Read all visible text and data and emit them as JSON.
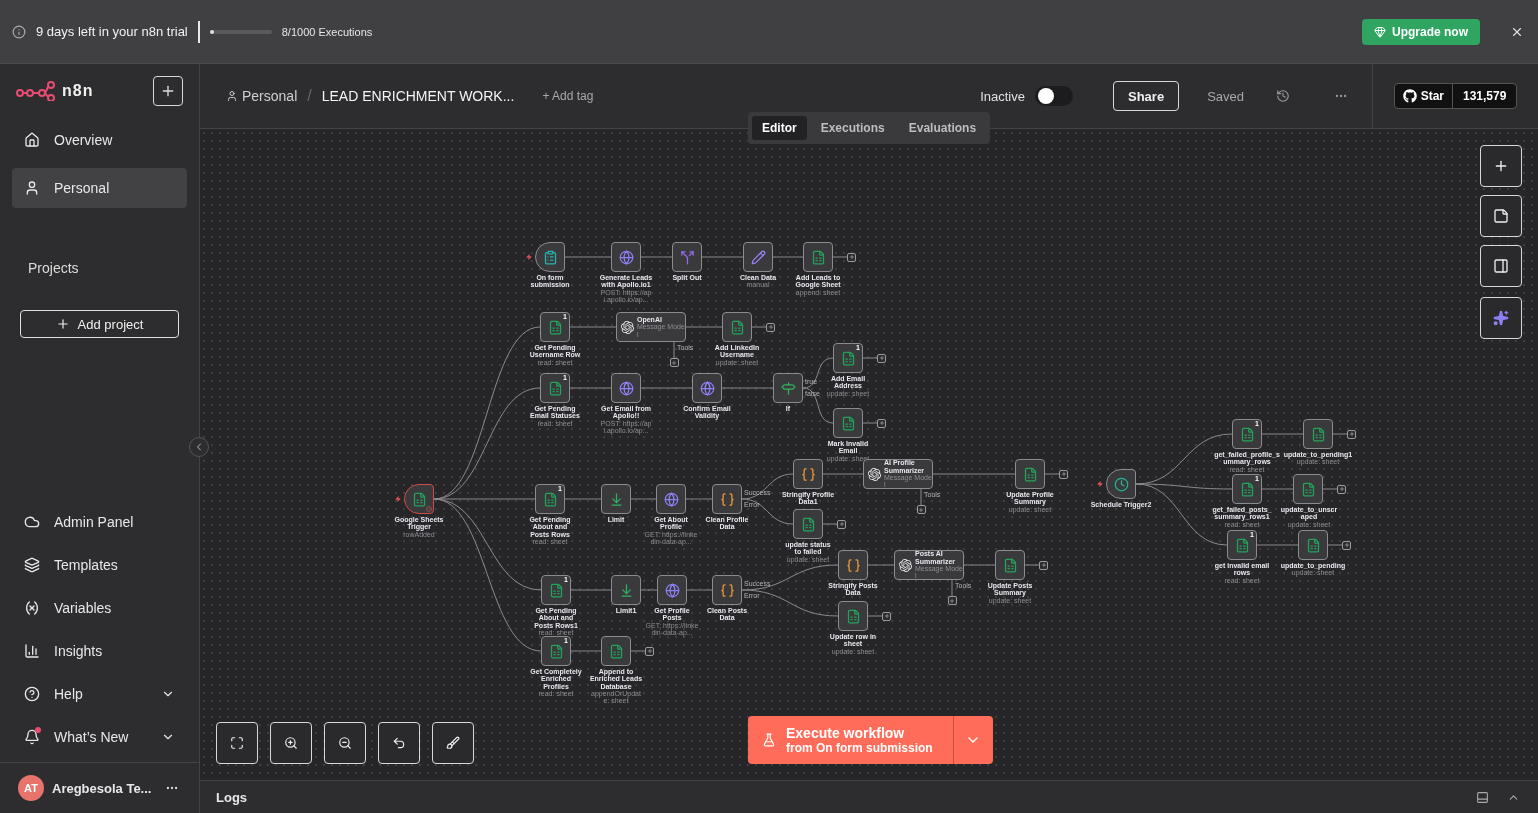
{
  "trial_banner": {
    "message": "9 days left in your n8n trial",
    "executions": {
      "level": 0.008,
      "reading": "8/1000 Executions"
    },
    "upgrade_button": "Upgrade now"
  },
  "sidebar": {
    "logo": "n8n",
    "items": [
      {
        "label": "Overview",
        "selected": false
      },
      {
        "label": "Personal",
        "selected": true
      }
    ],
    "projects_heading": "Projects",
    "add_project": "Add project",
    "bottom_items": [
      {
        "label": "Admin Panel",
        "chevron": false,
        "dot": false
      },
      {
        "label": "Templates",
        "chevron": false,
        "dot": false
      },
      {
        "label": "Variables",
        "chevron": false,
        "dot": false
      },
      {
        "label": "Insights",
        "chevron": false,
        "dot": false
      },
      {
        "label": "Help",
        "chevron": true,
        "dot": false
      },
      {
        "label": "What’s New",
        "chevron": true,
        "dot": true
      }
    ],
    "user": {
      "initials": "AT",
      "name": "Aregbesola Te..."
    }
  },
  "header": {
    "breadcrumb": "Personal",
    "separator": "/",
    "workflow_name": "LEAD ENRICHMENT WORK...",
    "add_tag": "+ Add tag",
    "active_label": "Inactive",
    "active": false,
    "share": "Share",
    "save_state": "Saved",
    "github": {
      "label": "Star",
      "count": "131,579"
    }
  },
  "tabs": [
    {
      "label": "Editor",
      "selected": true
    },
    {
      "label": "Executions",
      "selected": false
    },
    {
      "label": "Evaluations",
      "selected": false
    }
  ],
  "canvas": {
    "nodes": [
      {
        "name": "On form submission",
        "kind": "formTrigger",
        "open_output": false
      },
      {
        "name": "Generate Leads with Apollo.io1",
        "subtitle": "POST: https://api.apollo.io/ap...",
        "kind": "http",
        "open_output": false
      },
      {
        "name": "Split Out",
        "kind": "split",
        "open_output": false
      },
      {
        "name": "Clean Data",
        "subtitle": "manual",
        "kind": "set",
        "open_output": false
      },
      {
        "name": "Add Leads to Google Sheet",
        "subtitle": "append: sheet",
        "kind": "sheets",
        "open_output": true
      },
      {
        "name": "Get Pending Username Row",
        "subtitle": "read: sheet",
        "kind": "sheets",
        "badge": "1",
        "open_output": false
      },
      {
        "name": "OpenAI",
        "subtitle": "Message Model",
        "kind": "ai",
        "tools": "Tools",
        "open_output": false
      },
      {
        "name": "Add LinkedIn Username",
        "subtitle": "update: sheet",
        "kind": "sheets",
        "open_output": true
      },
      {
        "name": "Get Pending Email Statuses",
        "subtitle": "read: sheet",
        "kind": "sheets",
        "badge": "1",
        "open_output": false
      },
      {
        "name": "Get Email from Apollo!!",
        "subtitle": "POST: https://api.apollo.io/ap...",
        "kind": "http",
        "open_output": false
      },
      {
        "name": "Confirm Email Validity",
        "kind": "http",
        "open_output": false
      },
      {
        "name": "If",
        "kind": "if",
        "outputs": [
          "true",
          "false"
        ],
        "open_output": false
      },
      {
        "name": "Add Email Address",
        "subtitle": "update: sheet",
        "kind": "sheets",
        "badge": "1",
        "open_output": true
      },
      {
        "name": "Mark Invalid Email",
        "subtitle": "update: sheet",
        "kind": "sheets",
        "open_output": true
      },
      {
        "name": "Google Sheets Trigger",
        "subtitle": "rowAdded",
        "kind": "sheetsTrigger",
        "error": true,
        "open_output": false
      },
      {
        "name": "Get Pending About and Posts Rows",
        "subtitle": "read: sheet",
        "kind": "sheets",
        "badge": "1",
        "open_output": false
      },
      {
        "name": "Limit",
        "kind": "limit",
        "open_output": false
      },
      {
        "name": "Get About Profile",
        "subtitle": "GET: https://linkedin-data-ap...",
        "kind": "http",
        "open_output": false
      },
      {
        "name": "Clean Profile Data",
        "kind": "code",
        "outputs": [
          "Success",
          "Error"
        ],
        "open_output": false
      },
      {
        "name": "Stringify Profile Data1",
        "kind": "code",
        "open_output": false
      },
      {
        "name": "AI Profile Summarizer",
        "subtitle": "Message Model",
        "kind": "ai",
        "tools": "Tools",
        "open_output": false
      },
      {
        "name": "Update Profile Summary",
        "subtitle": "update: sheet",
        "kind": "sheets",
        "open_output": true
      },
      {
        "name": "update status to failed",
        "subtitle": "update: sheet",
        "kind": "sheets",
        "open_output": true
      },
      {
        "name": "Get Pending About and Posts Rows1",
        "subtitle": "read: sheet",
        "kind": "sheets",
        "badge": "1",
        "open_output": false
      },
      {
        "name": "Limit1",
        "kind": "limit",
        "open_output": false
      },
      {
        "name": "Get Profile Posts",
        "subtitle": "GET: https://linkedin-data-ap...",
        "kind": "http",
        "open_output": false
      },
      {
        "name": "Clean Posts Data",
        "kind": "code",
        "outputs": [
          "Success",
          "Error"
        ],
        "open_output": false
      },
      {
        "name": "Stringify Posts Data",
        "kind": "code",
        "open_output": false
      },
      {
        "name": "Posts AI Summarizer",
        "subtitle": "Message Model",
        "kind": "ai",
        "tools": "Tools",
        "open_output": false
      },
      {
        "name": "Update Posts Summary",
        "subtitle": "update: sheet",
        "kind": "sheets",
        "open_output": true
      },
      {
        "name": "Update row in sheet",
        "subtitle": "update: sheet",
        "kind": "sheets",
        "open_output": true
      },
      {
        "name": "Get Completely Enriched Profiles",
        "subtitle": "read: sheet",
        "kind": "sheets",
        "badge": "1",
        "open_output": false
      },
      {
        "name": "Append to Enriched Leads Database",
        "subtitle": "appendOrUpdate: sheet",
        "kind": "sheets",
        "open_output": true
      },
      {
        "name": "Schedule Trigger2",
        "kind": "scheduleTrigger",
        "open_output": false
      },
      {
        "name": "get_failed_profile_summary_rows",
        "subtitle": "read: sheet",
        "kind": "sheets",
        "badge": "1",
        "open_output": false
      },
      {
        "name": "update_to_pending1",
        "subtitle": "update: sheet",
        "kind": "sheets",
        "open_output": true
      },
      {
        "name": "get_failed_posts_summary_rows1",
        "subtitle": "read: sheet",
        "kind": "sheets",
        "badge": "1",
        "open_output": false
      },
      {
        "name": "update_to_unscraped",
        "subtitle": "update: sheet",
        "kind": "sheets",
        "open_output": true
      },
      {
        "name": "get invalid email rows",
        "subtitle": "read: sheet",
        "kind": "sheets",
        "badge": "1",
        "open_output": false
      },
      {
        "name": "update_to_pending",
        "subtitle": "update: sheet",
        "kind": "sheets",
        "open_output": true
      }
    ]
  },
  "execute_button": {
    "title": "Execute workflow",
    "subtitle": "from On form submission"
  },
  "logs_bar": {
    "label": "Logs"
  }
}
